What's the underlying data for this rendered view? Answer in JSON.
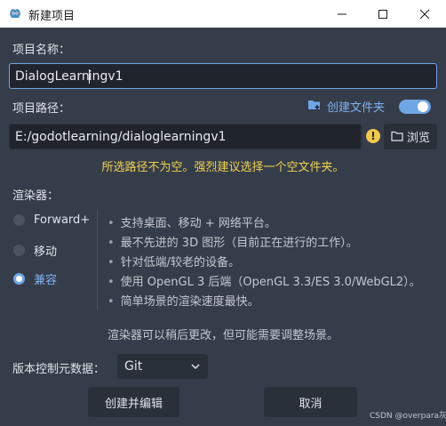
{
  "window": {
    "title": "新建项目"
  },
  "project_name": {
    "label": "项目名称：",
    "value_before_caret": "DialogLearn",
    "value_after_caret": "ingv1"
  },
  "project_path": {
    "label": "项目路径：",
    "create_folder_label": "创建文件夹",
    "create_folder_enabled": true,
    "value": "E:/godotlearning/dialoglearningv1",
    "browse_label": "浏览",
    "warning_icon_glyph": "!",
    "warning": "所选路径不为空。强烈建议选择一个空文件夹。"
  },
  "renderer": {
    "label": "渲染器：",
    "options": [
      {
        "label": "Forward+",
        "checked": false
      },
      {
        "label": "移动",
        "checked": false
      },
      {
        "label": "兼容",
        "checked": true
      }
    ],
    "features": [
      "支持桌面、移动 + 网络平台。",
      "最不先进的 3D 图形（目前正在进行的工作）。",
      "针对低端/较老的设备。",
      "使用 OpenGL 3 后端（OpenGL 3.3/ES 3.0/WebGL2）。",
      "简单场景的渲染速度最快。"
    ],
    "bullet": "•",
    "note": "渲染器可以稍后更改，但可能需要调整场景。"
  },
  "vcs": {
    "label": "版本控制元数据：",
    "selected": "Git"
  },
  "buttons": {
    "create": "创建并编辑",
    "cancel": "取消"
  },
  "watermark": "CSDN @overpara灰",
  "colors": {
    "accent": "#6fa6e6",
    "warning": "#f0d252",
    "background": "#363d4a"
  }
}
